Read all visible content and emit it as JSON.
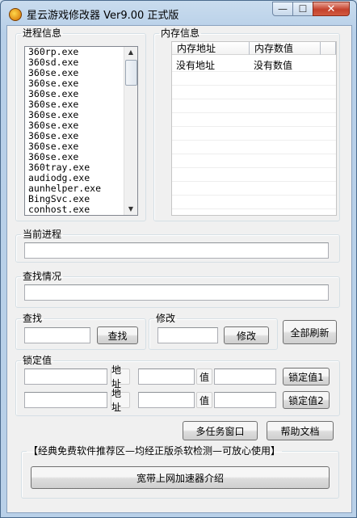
{
  "window": {
    "title": "星云游戏修改器 Ver9.00 正式版",
    "minimize_glyph": "—",
    "maximize_glyph": "☐",
    "close_glyph": "✕"
  },
  "process_group": {
    "legend": "进程信息",
    "processes": [
      "360rp.exe",
      "360sd.exe",
      "360se.exe",
      "360se.exe",
      "360se.exe",
      "360se.exe",
      "360se.exe",
      "360se.exe",
      "360se.exe",
      "360se.exe",
      "360se.exe",
      "360tray.exe",
      "audiodg.exe",
      "aunhelper.exe",
      "BingSvc.exe",
      "conhost.exe"
    ],
    "scroll_up_glyph": "▲",
    "scroll_down_glyph": "▼"
  },
  "memory_group": {
    "legend": "内存信息",
    "columns": [
      "内存地址",
      "内存数值"
    ],
    "rows": [
      [
        "没有地址",
        "没有数值"
      ]
    ]
  },
  "current_process": {
    "legend": "当前进程",
    "value": ""
  },
  "search_status": {
    "legend": "查找情况",
    "value": ""
  },
  "find_group": {
    "legend": "查找",
    "value": "",
    "button": "查找"
  },
  "modify_group": {
    "legend": "修改",
    "value": "",
    "button": "修改"
  },
  "refresh_all_button": "全部刷新",
  "lock_group": {
    "legend": "锁定值",
    "address_label": "地址",
    "value_label": "值",
    "rows": [
      {
        "button": "锁定值1"
      },
      {
        "button": "锁定值2"
      }
    ]
  },
  "multitask_button": "多任务窗口",
  "help_button": "帮助文档",
  "promo_group": {
    "legend": "【经典免费软件推荐区—均经正版杀软检测—可放心使用】",
    "button": "宽带上网加速器介绍"
  },
  "colors": {
    "title_bar": "#b9d0e8",
    "close_button": "#c4412c",
    "client_bg": "#f0f0f0"
  }
}
